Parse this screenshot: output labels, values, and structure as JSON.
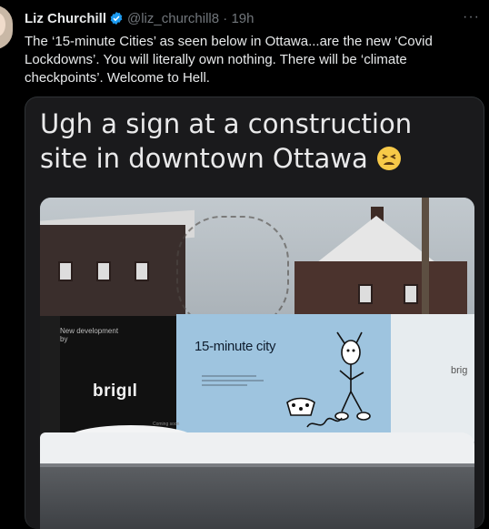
{
  "tweet": {
    "author_name": "Liz Churchill",
    "handle": "@liz_churchill8",
    "separator": "·",
    "time": "19h",
    "more_label": "···",
    "text": "The ‘15-minute Cities’ as seen below in Ottawa...are the new ‘Covid Lockdowns’. You will literally own nothing. There will be ‘climate checkpoints’. Welcome to Hell."
  },
  "media": {
    "caption": "Ugh a sign at a construction site in downtown Ottawa",
    "caption_emoji": "tired-face-emoji",
    "sign": {
      "new_development": "New development by",
      "brand_left": "brigıl",
      "headline": "15-minute city",
      "brand_right": "brig",
      "coming": "Coming soon"
    }
  },
  "colors": {
    "background": "#000000",
    "text": "#e7e9ea",
    "muted": "#71767b",
    "verified": "#1d9bf0",
    "hoarding_blue": "#9ec4df"
  }
}
